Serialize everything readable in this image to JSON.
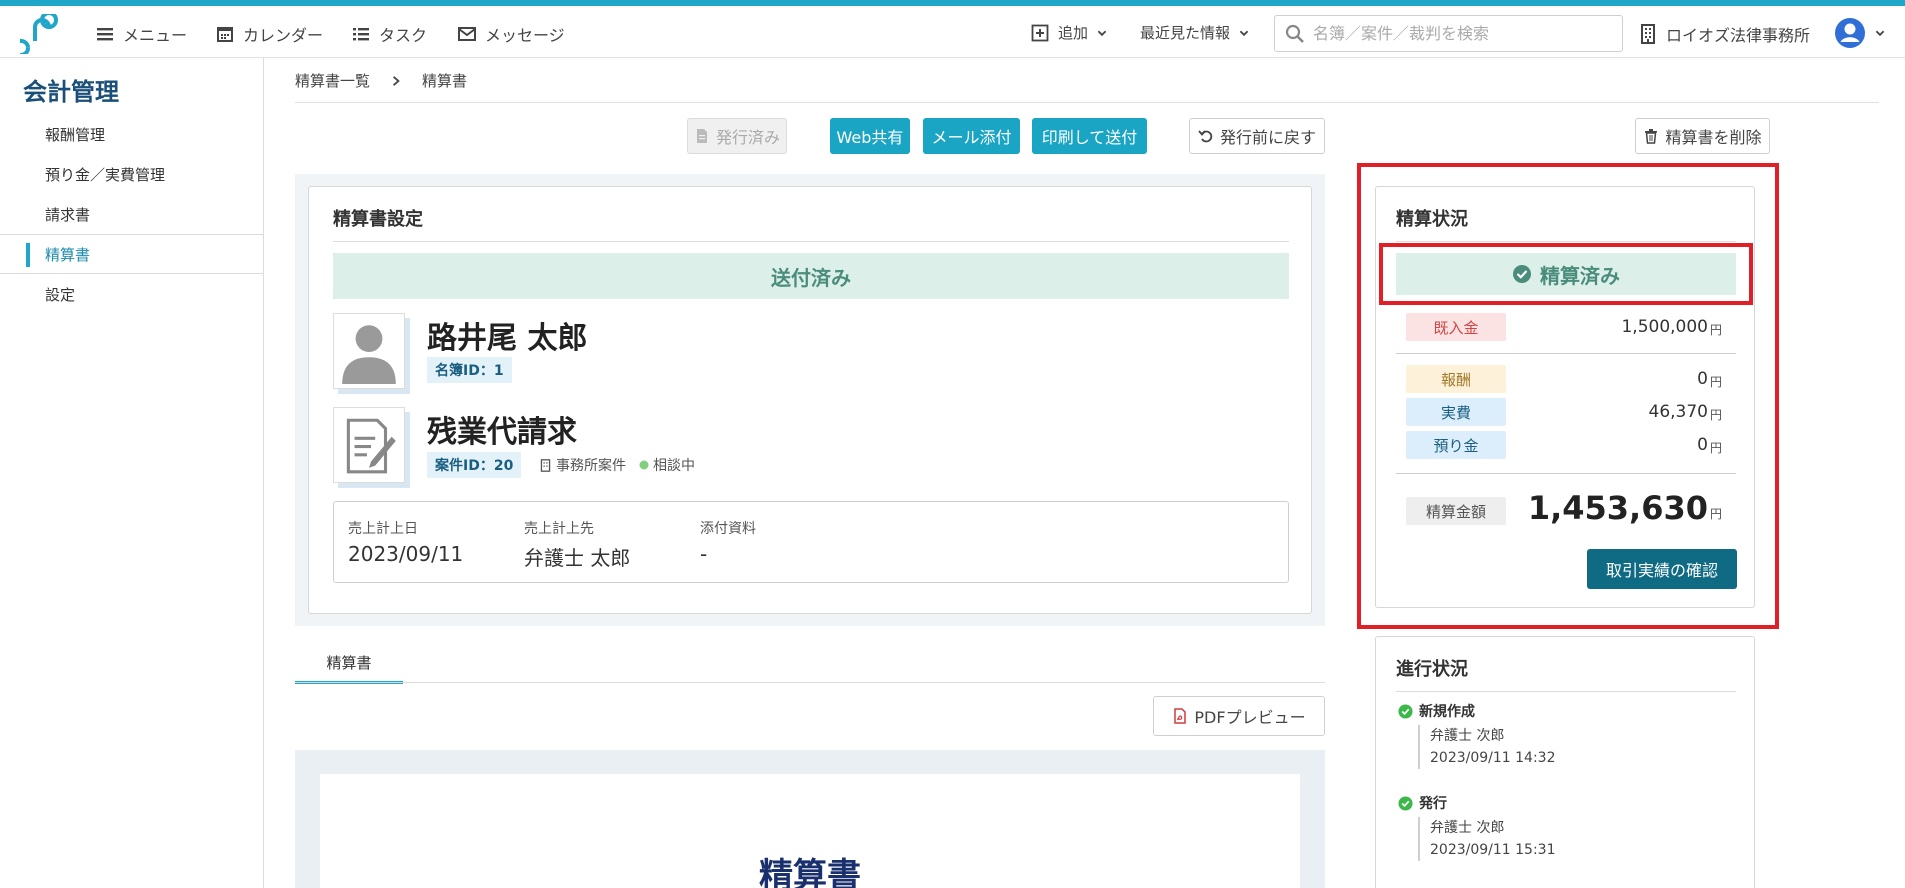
{
  "header": {
    "nav": [
      "メニュー",
      "カレンダー",
      "タスク",
      "メッセージ"
    ],
    "add_label": "追加",
    "recent_label": "最近見た情報",
    "search_placeholder": "名簿／案件／裁判を検索",
    "office_name": "ロイオズ法律事務所"
  },
  "sidebar": {
    "title": "会計管理",
    "items": [
      "報酬管理",
      "預り金／実費管理",
      "請求書",
      "精算書",
      "設定"
    ],
    "active_index": 3
  },
  "breadcrumb": {
    "parent": "精算書一覧",
    "current": "精算書"
  },
  "actions": {
    "issued": "発行済み",
    "web_share": "Web共有",
    "mail_attach": "メール添付",
    "print_send": "印刷して送付",
    "revert": "発行前に戻す",
    "delete": "精算書を削除"
  },
  "settings": {
    "title": "精算書設定",
    "status": "送付済み",
    "client_name": "路井尾 太郎",
    "client_id": "名簿ID：1",
    "case_name": "残業代請求",
    "case_id": "案件ID：20",
    "case_type": "事務所案件",
    "case_status": "相談中",
    "labels": {
      "date": "売上計上日",
      "recipient": "売上計上先",
      "attachments": "添付資料"
    },
    "values": {
      "date": "2023/09/11",
      "recipient": "弁護士 太郎",
      "attachments": "-"
    }
  },
  "tabs": {
    "active": "精算書"
  },
  "preview": {
    "pdf_button": "PDFプレビュー",
    "title": "精算書"
  },
  "settlement": {
    "title": "精算状況",
    "status": "精算済み",
    "deposit_label": "既入金",
    "deposit_value": "1,500,000",
    "fee_label": "報酬",
    "fee_value": "0",
    "expense_label": "実費",
    "expense_value": "46,370",
    "custody_label": "預り金",
    "custody_value": "0",
    "total_label": "精算金額",
    "total_value": "1,453,630",
    "yen": "円",
    "confirm_button": "取引実績の確認"
  },
  "progress": {
    "title": "進行状況",
    "steps": [
      {
        "name": "新規作成",
        "person": "弁護士 次郎",
        "time": "2023/09/11 14:32"
      },
      {
        "name": "発行",
        "person": "弁護士 次郎",
        "time": "2023/09/11 15:31"
      }
    ]
  },
  "colors": {
    "accent": "#1fa6c9",
    "primary_button": "#1aa5c4",
    "dark_button": "#0f6a84",
    "status_bg": "#dcefe9",
    "highlight": "#e01f27"
  }
}
